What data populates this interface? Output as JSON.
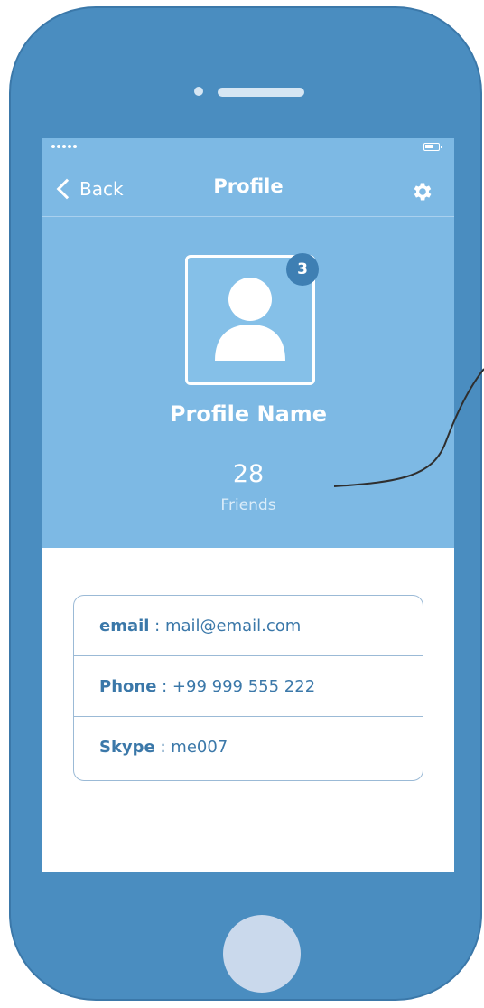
{
  "nav": {
    "back_label": "Back",
    "title": "Profile",
    "settings_icon": "gear-icon"
  },
  "profile": {
    "avatar_icon": "user-icon",
    "notification_count": "3",
    "name": "Profile Name",
    "friends_count": "28",
    "friends_label": "Friends"
  },
  "contact": [
    {
      "key": "email",
      "separator": " : ",
      "value": "mail@email.com"
    },
    {
      "key": "Phone",
      "separator": " : ",
      "value": "+99 999 555 222"
    },
    {
      "key": "Skype",
      "separator": " : ",
      "value": "me007"
    }
  ],
  "colors": {
    "phone_body": "#4a8dc0",
    "screen_header": "#7db9e4",
    "badge": "#3e7fb3",
    "contact_text": "#3b78a9"
  }
}
